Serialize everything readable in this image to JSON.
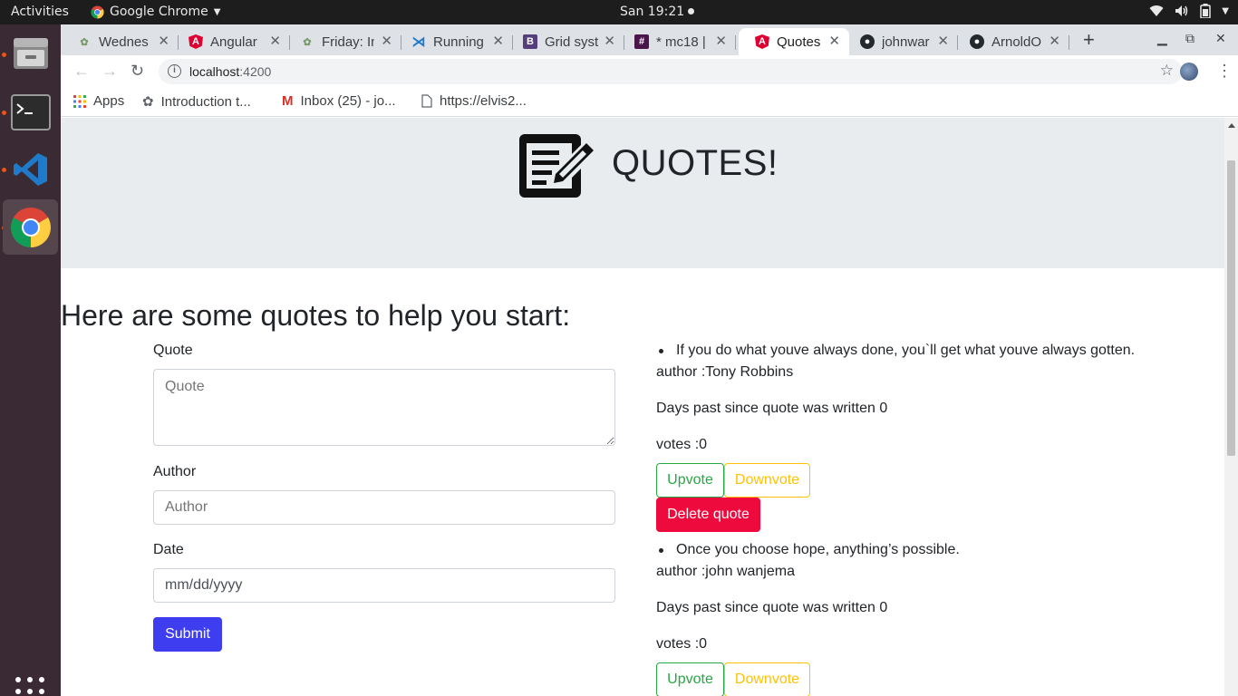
{
  "topbar": {
    "activities": "Activities",
    "app_name": "Google Chrome",
    "clock": "San 19:21"
  },
  "dock": {
    "items": [
      "file-manager-icon",
      "terminal-icon",
      "vscode-icon",
      "chrome-icon"
    ]
  },
  "browser": {
    "tabs": [
      {
        "label": "Wednes",
        "icon": "plant-icon"
      },
      {
        "label": "Angular",
        "icon": "angular-icon"
      },
      {
        "label": "Friday: In",
        "icon": "plant-icon"
      },
      {
        "label": "Running",
        "icon": "vscode-icon"
      },
      {
        "label": "Grid syst",
        "icon": "bootstrap-icon"
      },
      {
        "label": "* mc18 |",
        "icon": "slack-icon"
      },
      {
        "label": "Quotes",
        "icon": "angular-icon"
      },
      {
        "label": "johnwar",
        "icon": "github-icon"
      },
      {
        "label": "ArnoldO",
        "icon": "github-icon"
      }
    ],
    "url_host": "localhost",
    "url_port": ":4200",
    "bookmarks": [
      {
        "label": "Apps",
        "icon": "apps-grid-icon"
      },
      {
        "label": "Introduction t...",
        "icon": "plant-icon"
      },
      {
        "label": "Inbox (25) - jo...",
        "icon": "gmail-icon"
      },
      {
        "label": "https://elvis2...",
        "icon": "page-icon"
      }
    ]
  },
  "page": {
    "title": "QUOTES!",
    "intro": "Here are some quotes to help you start:",
    "form": {
      "quote_label": "Quote",
      "quote_placeholder": "Quote",
      "author_label": "Author",
      "author_placeholder": "Author",
      "date_label": "Date",
      "date_placeholder": "mm/dd/yyyy",
      "submit_label": "Submit"
    },
    "quotes": [
      {
        "text": "If you do what youve always done, you`ll get what youve always gotten.",
        "author": "author :Tony Robbins",
        "days": "Days past since quote was written 0",
        "votes": "votes :0",
        "upvote": "Upvote",
        "downvote": "Downvote",
        "delete": "Delete quote"
      },
      {
        "text": "Once you choose hope, anything’s possible.",
        "author": "author :john wanjema",
        "days": "Days past since quote was written 0",
        "votes": "votes :0",
        "upvote": "Upvote",
        "downvote": "Downvote"
      }
    ]
  },
  "colors": {
    "submit": "#3e3ef0",
    "upvote": "#28a745",
    "downvote": "#ffc107",
    "delete": "#ee0a3d",
    "jumbotron": "#e9ecef"
  }
}
